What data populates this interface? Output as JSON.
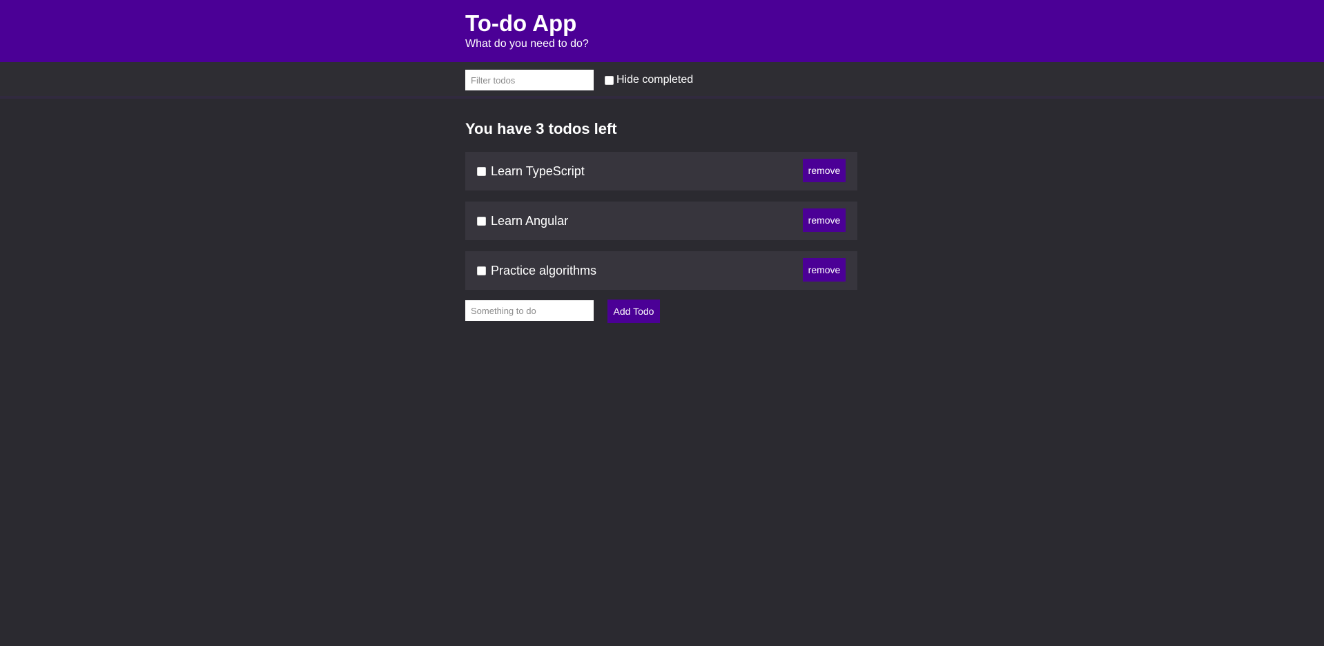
{
  "header": {
    "title": "To-do App",
    "subtitle": "What do you need to do?"
  },
  "toolbar": {
    "filter_placeholder": "Filter todos",
    "filter_value": "",
    "hide_completed_label": "Hide completed",
    "hide_completed_checked": false
  },
  "main": {
    "todos_left_text": "You have 3 todos left",
    "todos": [
      {
        "label": "Learn TypeScript",
        "done": false,
        "remove_label": "remove"
      },
      {
        "label": "Learn Angular",
        "done": false,
        "remove_label": "remove"
      },
      {
        "label": "Practice algorithms",
        "done": false,
        "remove_label": "remove"
      }
    ],
    "add": {
      "placeholder": "Something to do",
      "value": "",
      "button_label": "Add Todo"
    }
  },
  "colors": {
    "accent": "#4b0096",
    "background": "#2b2a30",
    "item_background": "#37353d",
    "text": "#ffffff"
  }
}
